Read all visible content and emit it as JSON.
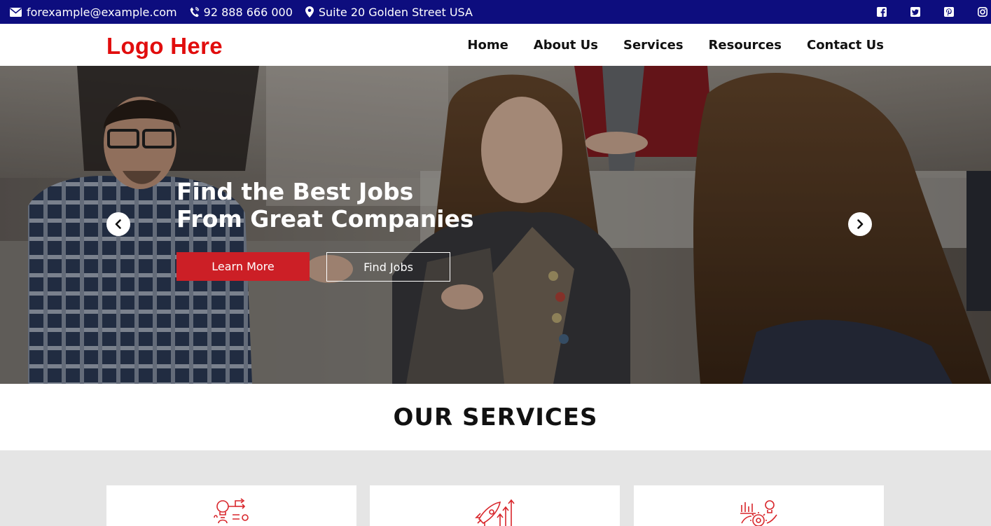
{
  "topbar": {
    "email": "forexample@example.com",
    "phone": "92 888 666 000",
    "address": "Suite 20 Golden Street USA",
    "icons": [
      "envelope-icon",
      "phone-icon",
      "map-marker-icon"
    ],
    "social": [
      "facebook-icon",
      "twitter-icon",
      "pinterest-icon",
      "instagram-icon"
    ]
  },
  "header": {
    "logo": "Logo Here",
    "nav": [
      "Home",
      "About Us",
      "Services",
      "Resources",
      "Contact Us"
    ]
  },
  "hero": {
    "title_line1": "Find the Best Jobs",
    "title_line2": "From Great Companies",
    "primary_button": "Learn More",
    "secondary_button": "Find Jobs",
    "prev_icon": "chevron-left-icon",
    "next_icon": "chevron-right-icon"
  },
  "services": {
    "title": "OUR SERVICES",
    "cards": [
      {
        "icon": "idea-gears-icon"
      },
      {
        "icon": "rocket-growth-icon"
      },
      {
        "icon": "analytics-gear-icon"
      }
    ]
  },
  "colors": {
    "topbar_bg": "#0d0d7e",
    "brand_red": "#e10d0d",
    "button_red": "#cc1f26",
    "band_gray": "#e5e5e5"
  }
}
